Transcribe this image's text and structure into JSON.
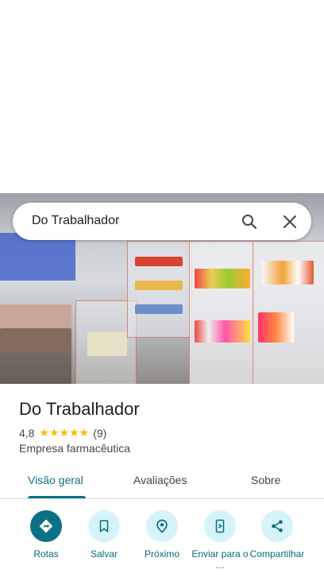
{
  "search": {
    "query": "Do Trabalhador"
  },
  "place": {
    "name": "Do Trabalhador",
    "rating": "4,8",
    "stars": "★★★★★",
    "reviews": "(9)",
    "category": "Empresa farmacêutica"
  },
  "tabs": [
    {
      "label": "Visão geral"
    },
    {
      "label": "Avaliações"
    },
    {
      "label": "Sobre"
    }
  ],
  "actions": [
    {
      "label": "Rotas",
      "icon": "directions-icon"
    },
    {
      "label": "Salvar",
      "icon": "bookmark-icon"
    },
    {
      "label": "Próximo",
      "icon": "nearby-icon"
    },
    {
      "label": "Enviar para o …",
      "icon": "send-to-phone-icon"
    },
    {
      "label": "Compartilhar",
      "icon": "share-icon"
    }
  ],
  "colors": {
    "accent": "#0b7285",
    "action_bg": "#d4f3fb",
    "star": "#fbbc04"
  }
}
